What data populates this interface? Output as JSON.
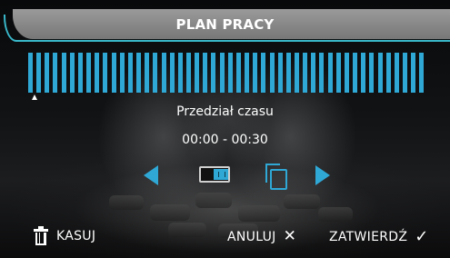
{
  "header": {
    "title": "PLAN PRACY"
  },
  "timeline": {
    "segments": 48,
    "accent": "#2fa8d6"
  },
  "section_label": "Przedział czasu",
  "time_range": "00:00 - 00:30",
  "controls": {
    "prev_icon": "arrow-left-icon",
    "toggle_icon": "toggle-switch-icon",
    "copy_icon": "copy-icon",
    "next_icon": "arrow-right-icon"
  },
  "footer": {
    "delete_label": "KASUJ",
    "cancel_label": "ANULUJ",
    "confirm_label": "ZATWIERDŹ"
  }
}
